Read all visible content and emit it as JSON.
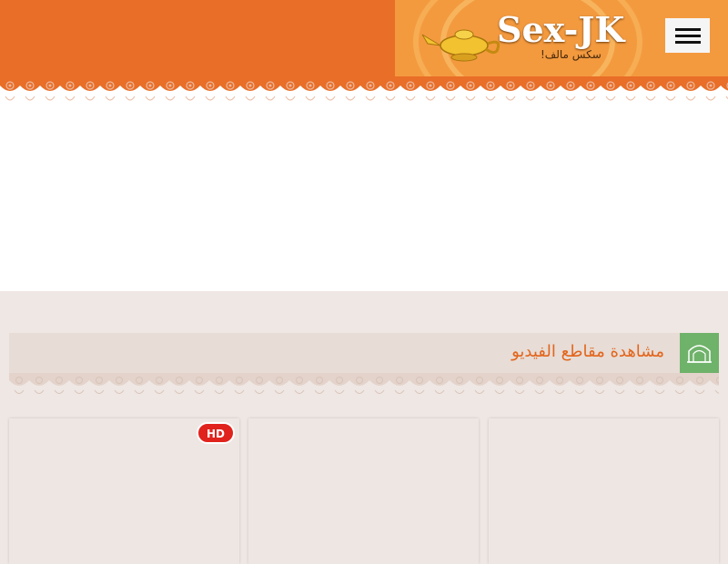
{
  "header": {
    "logo_text": "Sex-JK",
    "logo_subtitle": "سكس مالف!",
    "menu_icon": "hamburger-icon",
    "colors": {
      "bar": "#e96e27",
      "logo_bg": "#f39a3f",
      "ornament": "#e9b89e"
    }
  },
  "section": {
    "title": "مشاهدة مقاطع الفيديو",
    "icon": "gate-icon",
    "icon_color": "#6fb26a",
    "title_color": "#e2651c"
  },
  "cards": [
    {
      "badge": "HD"
    },
    {
      "badge": ""
    },
    {
      "badge": ""
    }
  ]
}
